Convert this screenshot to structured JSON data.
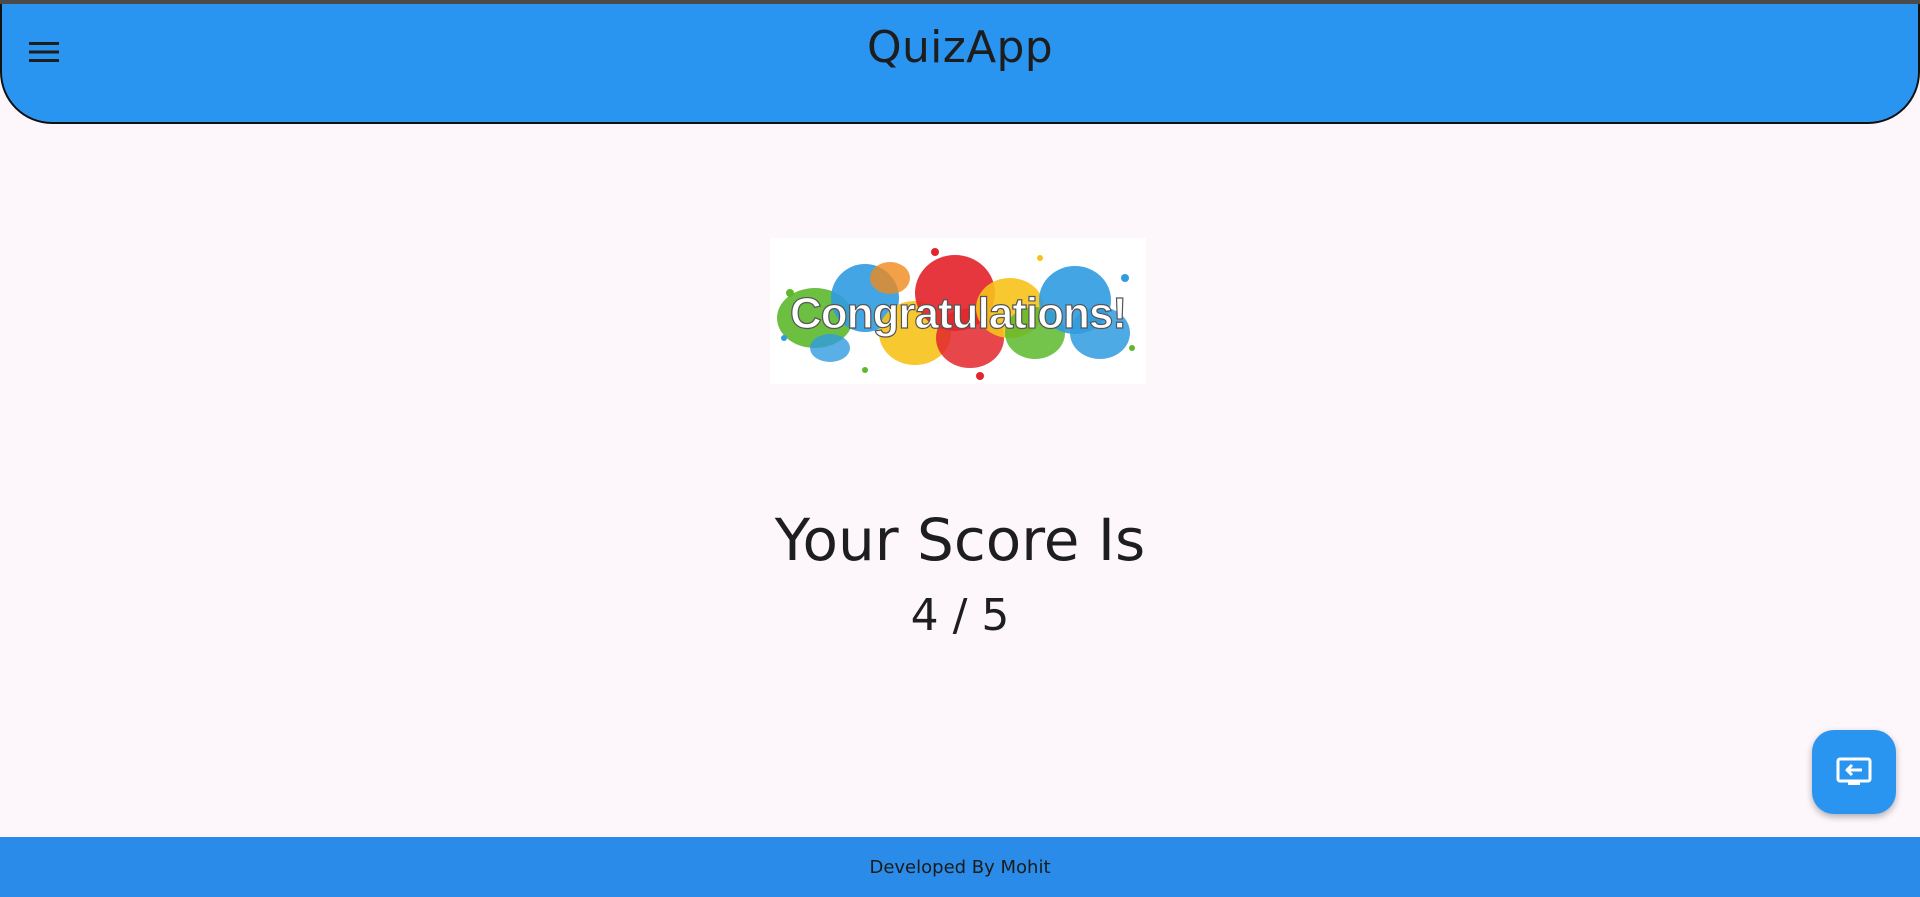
{
  "app_bar": {
    "title": "QuizApp",
    "menu_icon": "menu-icon"
  },
  "banner": {
    "text": "Congratulations!",
    "splash_colors": [
      "#e3262c",
      "#2f9be0",
      "#f6c21a",
      "#5cb82c",
      "#f08a1c"
    ]
  },
  "result": {
    "heading": "Your Score Is",
    "score": "4 / 5"
  },
  "fab": {
    "icon": "exit-to-app-icon"
  },
  "footer": {
    "text": "Developed By Mohit"
  },
  "colors": {
    "primary": "#2a95f1",
    "background": "#fdf7fc",
    "text": "#1e1e1e"
  }
}
